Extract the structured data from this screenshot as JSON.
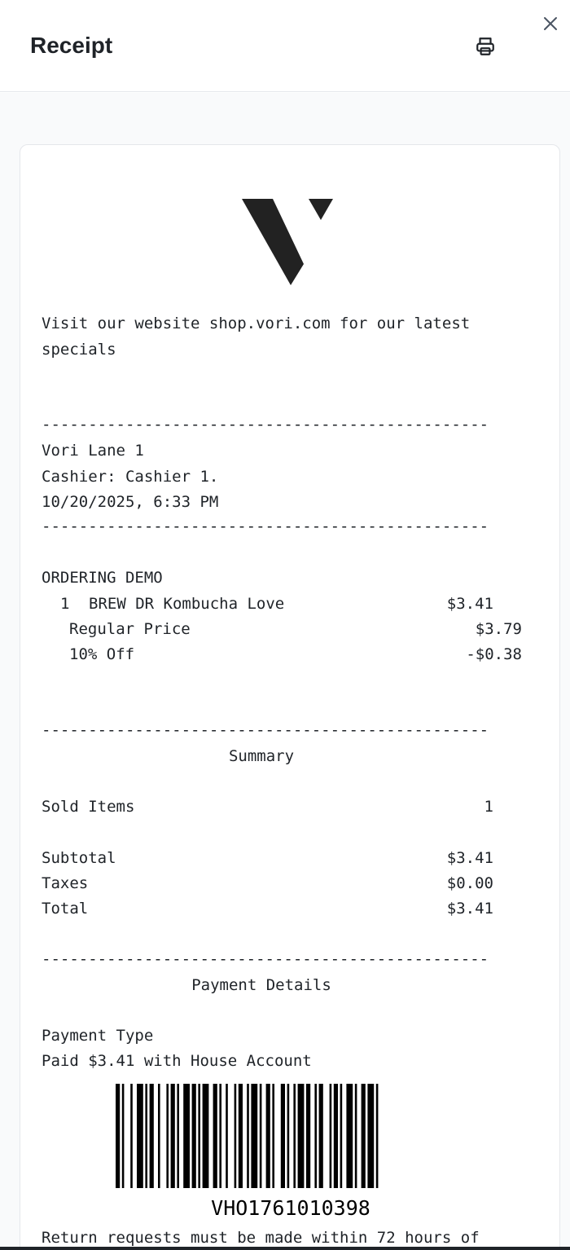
{
  "header": {
    "title": "Receipt",
    "print_icon": "printer-icon",
    "close_icon": "close-icon"
  },
  "receipt": {
    "logo": "vori-logo",
    "promo_line1": "Visit our website shop.vori.com for our latest",
    "promo_line2": "specials",
    "divider": "------------------------------------------------",
    "store": "Vori Lane 1",
    "cashier": "Cashier: Cashier 1.",
    "datetime": "10/20/2025, 6:33 PM",
    "order_name": "ORDERING DEMO",
    "items": [
      {
        "qty": "1",
        "name": "BREW DR Kombucha Love",
        "price": "$3.41"
      }
    ],
    "item_details": [
      {
        "label": "Regular Price",
        "value": "$3.79"
      },
      {
        "label": "10% Off",
        "value": "-$0.38"
      }
    ],
    "summary": {
      "heading": "Summary",
      "sold_items_label": "Sold Items",
      "sold_items_value": "1",
      "subtotal_label": "Subtotal",
      "subtotal_value": "$3.41",
      "taxes_label": "Taxes",
      "taxes_value": "$0.00",
      "total_label": "Total",
      "total_value": "$3.41"
    },
    "payment": {
      "heading": "Payment Details",
      "type_label": "Payment Type",
      "type_value": "Paid $3.41 with House Account"
    },
    "barcode_number": "VHO1761010398",
    "return_policy": "Return requests must be made within 72 hours of"
  }
}
